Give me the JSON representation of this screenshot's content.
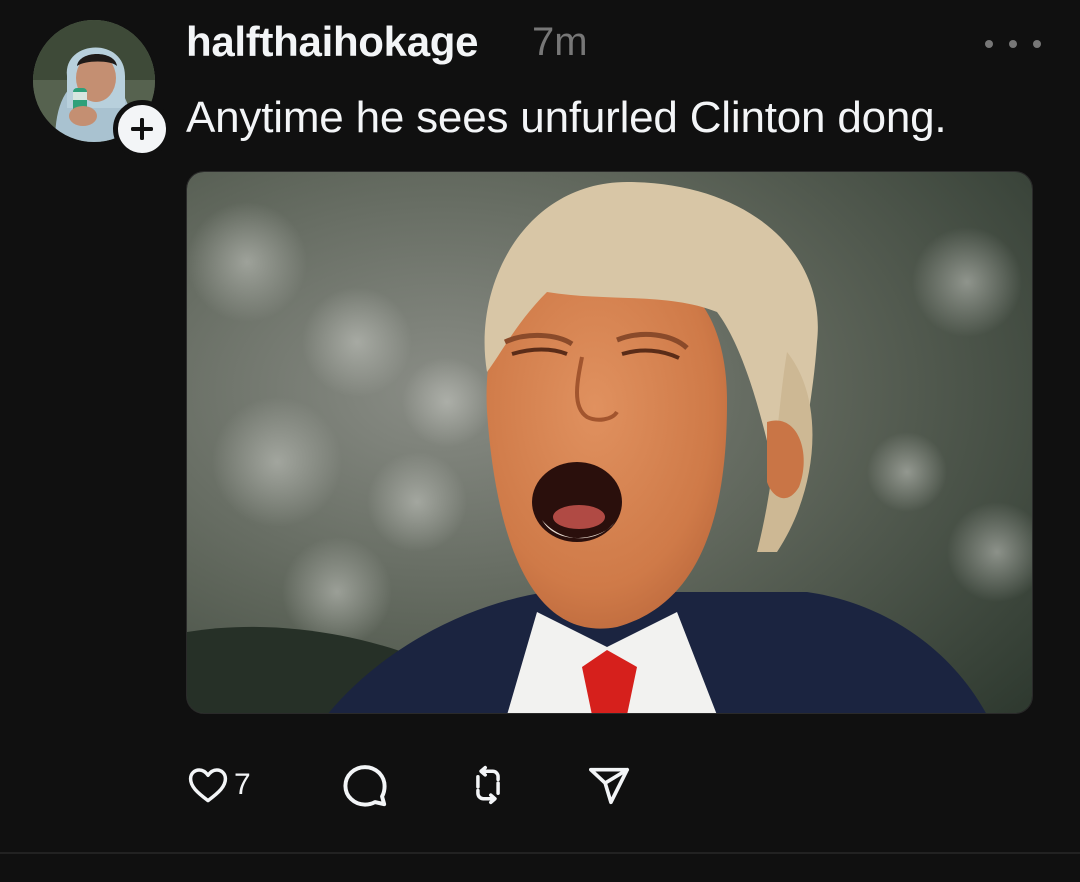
{
  "post": {
    "username": "halfthaihokage",
    "timestamp": "7m",
    "text": "Anytime he sees unfurled Clinton dong.",
    "like_count": "7"
  },
  "icons": {
    "follow": "plus-icon",
    "more": "more-horizontal-icon",
    "like": "heart-icon",
    "reply": "comment-icon",
    "repost": "repost-icon",
    "share": "send-icon"
  },
  "colors": {
    "background": "#101010",
    "primary_text": "#f3f5f7",
    "secondary_text": "#777777"
  }
}
